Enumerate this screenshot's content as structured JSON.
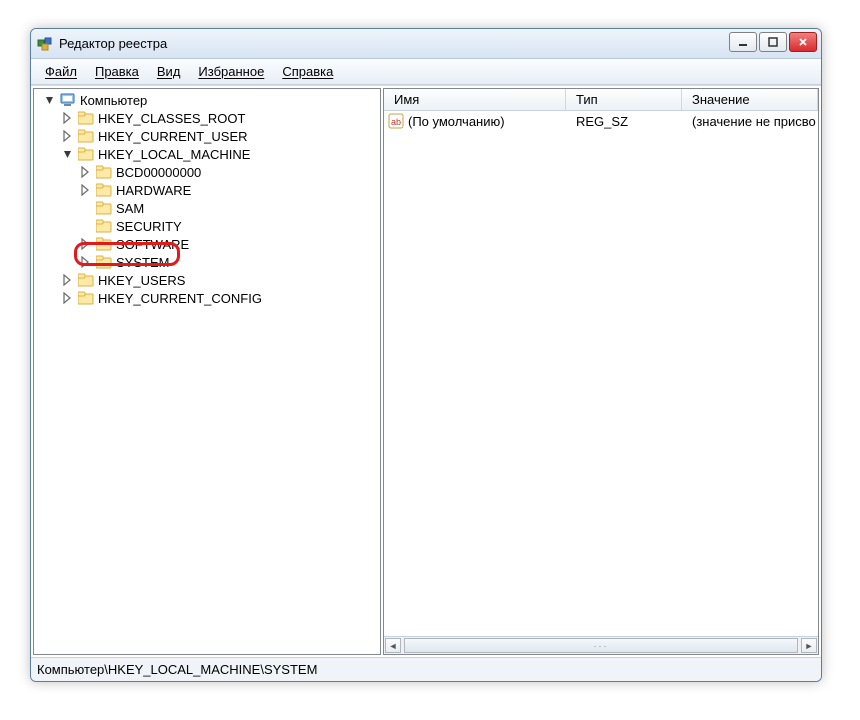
{
  "title": "Редактор реестра",
  "menu": {
    "file": "Файл",
    "edit": "Правка",
    "view": "Вид",
    "favorites": "Избранное",
    "help": "Справка"
  },
  "tree": {
    "root": "Компьютер",
    "hives": {
      "hkcr": "HKEY_CLASSES_ROOT",
      "hkcu": "HKEY_CURRENT_USER",
      "hklm": "HKEY_LOCAL_MACHINE",
      "hku": "HKEY_USERS",
      "hkcc": "HKEY_CURRENT_CONFIG"
    },
    "hklm_children": {
      "bcd": "BCD00000000",
      "hardware": "HARDWARE",
      "sam": "SAM",
      "security": "SECURITY",
      "software": "SOFTWARE",
      "system": "SYSTEM"
    }
  },
  "value_list": {
    "headers": {
      "name": "Имя",
      "type": "Тип",
      "value": "Значение"
    },
    "rows": [
      {
        "name": "(По умолчанию)",
        "type": "REG_SZ",
        "value": "(значение не присво"
      }
    ]
  },
  "statusbar": "Компьютер\\HKEY_LOCAL_MACHINE\\SYSTEM"
}
